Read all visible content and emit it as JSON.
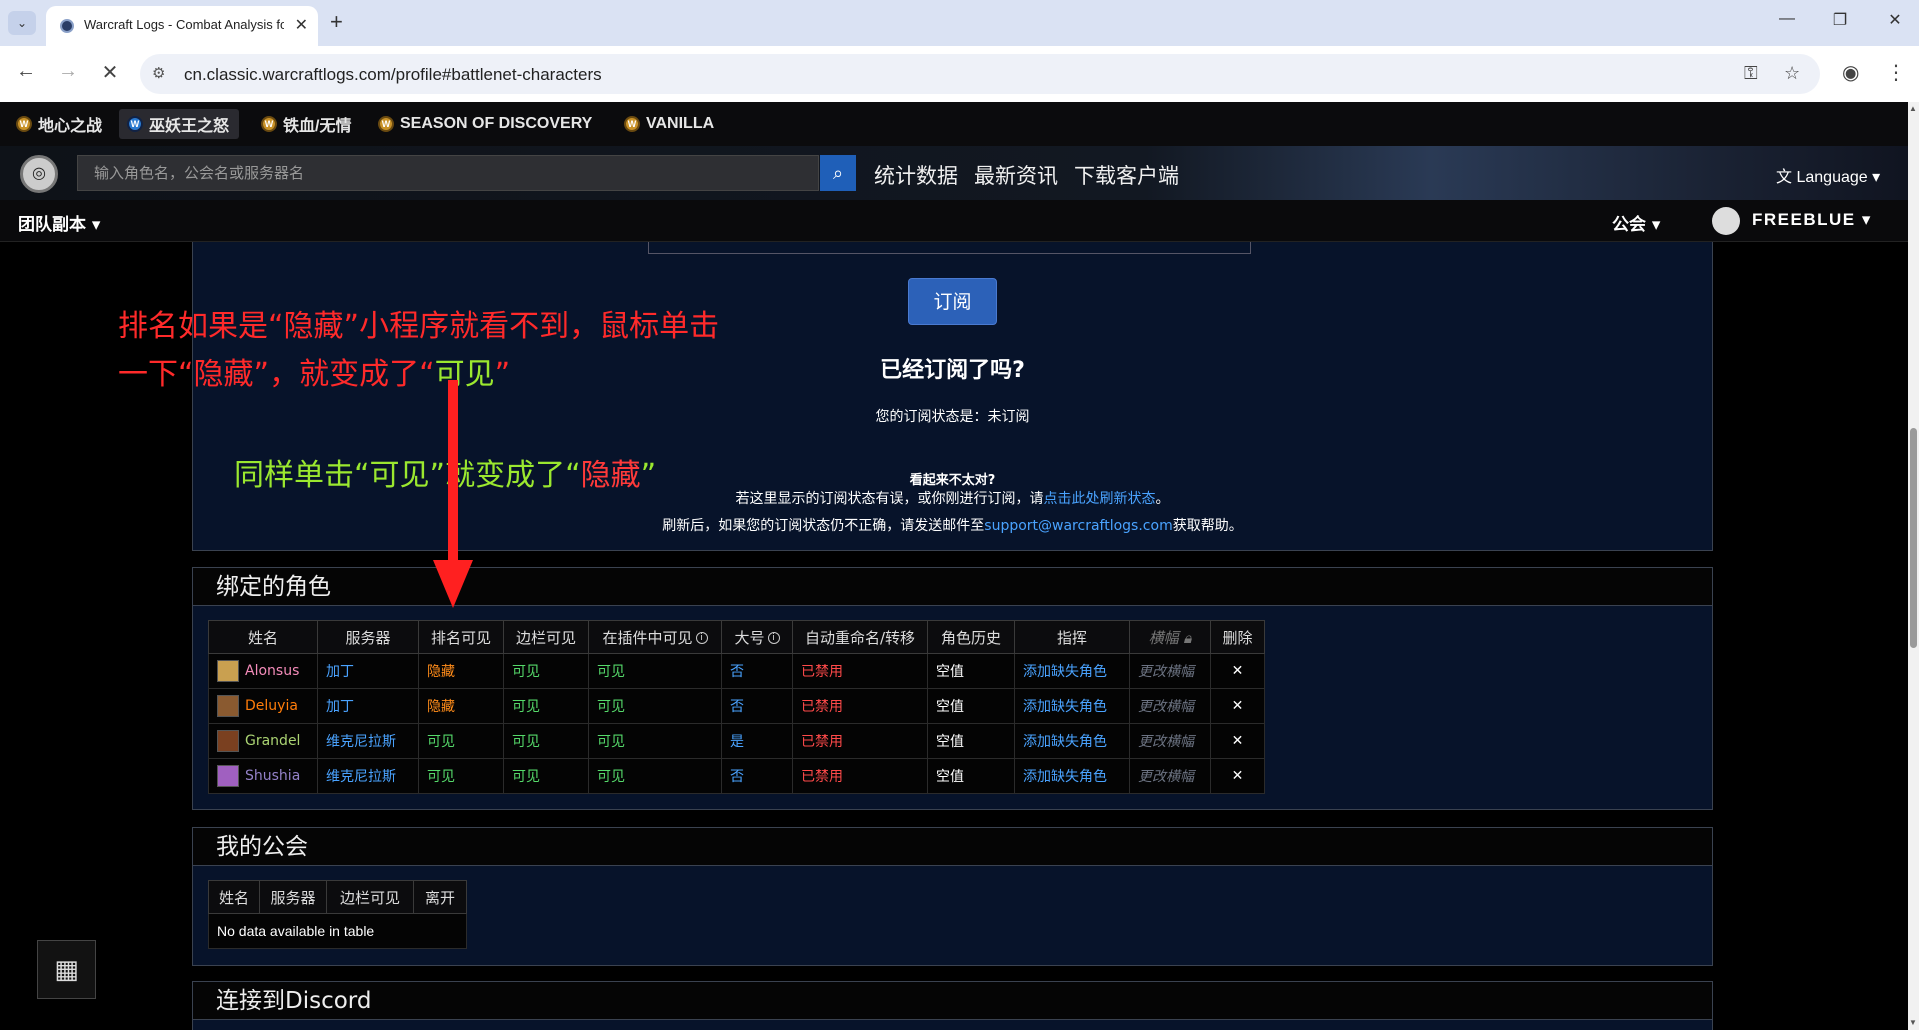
{
  "browser": {
    "tab_title": "Warcraft Logs - Combat Analysis fo",
    "url": "cn.classic.warcraftlogs.com/profile#battlenet-characters"
  },
  "game_tabs": [
    "地心之战",
    "巫妖王之怒",
    "铁血/无情",
    "SEASON OF DISCOVERY",
    "VANILLA"
  ],
  "header": {
    "search_placeholder": "输入角色名，公会名或服务器名",
    "nav": [
      "统计数据",
      "最新资讯",
      "下载客户端"
    ],
    "language": "Language"
  },
  "subnav": {
    "raids": "团队副本",
    "guild": "公会",
    "user": "FREEBLUE"
  },
  "subscription": {
    "button": "订阅",
    "question": "已经订阅了吗?",
    "status": "您的订阅状态是：未订阅",
    "wrong_title": "看起来不太对?",
    "line1_pre": "若这里显示的订阅状态有误，或你刚进行订阅，请",
    "line1_link": "点击此处刷新状态",
    "line1_post": "。",
    "line2_pre": "刷新后，如果您的订阅状态仍不正确，请发送邮件至",
    "line2_link": "support@warcraftlogs.com",
    "line2_post": "获取帮助。"
  },
  "characters": {
    "title": "绑定的角色",
    "headers": [
      "姓名",
      "服务器",
      "排名可见",
      "边栏可见",
      "在插件中可见",
      "大号",
      "自动重命名/转移",
      "角色历史",
      "指挥",
      "横幅",
      "删除"
    ],
    "rows": [
      {
        "name": "Alonsus",
        "server": "加丁",
        "rank": "隐藏",
        "sidebar": "可见",
        "addon": "可见",
        "main": "否",
        "rename": "已禁用",
        "history": "空值",
        "lead": "添加缺失角色",
        "banner": "更改横幅",
        "delete": "✕",
        "name_color": "#f58cba",
        "icon_color": "#c9a050"
      },
      {
        "name": "Deluyia",
        "server": "加丁",
        "rank": "隐藏",
        "sidebar": "可见",
        "addon": "可见",
        "main": "否",
        "rename": "已禁用",
        "history": "空值",
        "lead": "添加缺失角色",
        "banner": "更改横幅",
        "delete": "✕",
        "name_color": "#ff7d0a",
        "icon_color": "#8a5a30"
      },
      {
        "name": "Grandel",
        "server": "维克尼拉斯",
        "rank": "可见",
        "sidebar": "可见",
        "addon": "可见",
        "main": "是",
        "rename": "已禁用",
        "history": "空值",
        "lead": "添加缺失角色",
        "banner": "更改横幅",
        "delete": "✕",
        "name_color": "#abd473",
        "icon_color": "#7a4020"
      },
      {
        "name": "Shushia",
        "server": "维克尼拉斯",
        "rank": "可见",
        "sidebar": "可见",
        "addon": "可见",
        "main": "否",
        "rename": "已禁用",
        "history": "空值",
        "lead": "添加缺失角色",
        "banner": "更改横幅",
        "delete": "✕",
        "name_color": "#9482c9",
        "icon_color": "#a060c0"
      }
    ]
  },
  "guilds": {
    "title": "我的公会",
    "headers": [
      "姓名",
      "服务器",
      "边栏可见",
      "离开"
    ],
    "empty": "No data available in table"
  },
  "discord": {
    "title": "连接到Discord"
  },
  "annotations": {
    "line1_a": "排名如果是“隐藏”小程序就看不到，鼠标单击一下“隐藏”，就变成了“",
    "line1_b": "可见",
    "line1_c": "”",
    "line2_a": "同样单击“可见”就变成了“",
    "line2_b": "隐藏",
    "line2_c": "”"
  },
  "colors": {
    "accent_blue": "#2c61b8",
    "link_blue": "#4aa3ff",
    "visible_green": "#55d96a",
    "hidden_orange": "#ff8c1a",
    "disabled_red": "#ff4a4a",
    "annotation_red": "#ff2a2a",
    "annotation_green": "#9be82f"
  }
}
